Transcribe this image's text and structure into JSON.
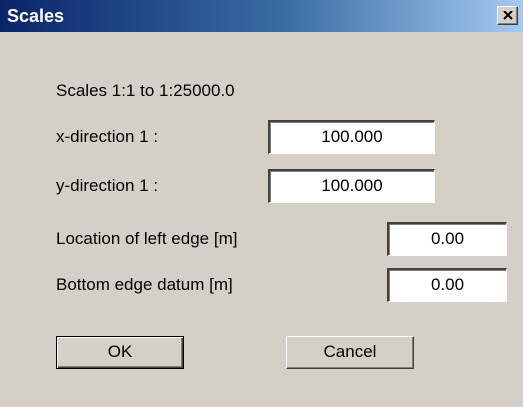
{
  "window": {
    "title": "Scales",
    "close_icon": "close-icon"
  },
  "info": {
    "scale_range": "Scales 1:1 to 1:25000.0"
  },
  "fields": {
    "x_direction": {
      "label": "x-direction 1 :",
      "value": "100.000"
    },
    "y_direction": {
      "label": "y-direction 1 :",
      "value": "100.000"
    },
    "left_edge": {
      "label": "Location of left edge [m]",
      "value": "0.00"
    },
    "bottom_edge": {
      "label": "Bottom edge datum [m]",
      "value": "0.00"
    }
  },
  "buttons": {
    "ok": "OK",
    "cancel": "Cancel"
  },
  "colors": {
    "titlebar_start": "#0a246a",
    "titlebar_end": "#a6caf0",
    "face": "#d4d0c8"
  }
}
